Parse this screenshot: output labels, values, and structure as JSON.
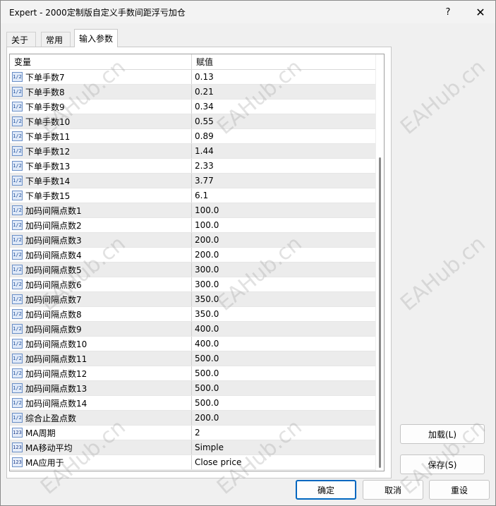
{
  "window": {
    "title": "Expert - 2000定制版自定义手数间距浮亏加仓",
    "help_glyph": "?",
    "close_glyph": "✕"
  },
  "tabs": [
    {
      "label": "关于",
      "active": false
    },
    {
      "label": "常用",
      "active": false
    },
    {
      "label": "输入参数",
      "active": true
    }
  ],
  "grid": {
    "headers": {
      "variable": "变量",
      "value": "赋值"
    },
    "rows": [
      {
        "icon": "double-value-icon",
        "icon_text": "1/2",
        "name": "下单手数7",
        "value": "0.13"
      },
      {
        "icon": "double-value-icon",
        "icon_text": "1/2",
        "name": "下单手数8",
        "value": "0.21"
      },
      {
        "icon": "double-value-icon",
        "icon_text": "1/2",
        "name": "下单手数9",
        "value": "0.34"
      },
      {
        "icon": "double-value-icon",
        "icon_text": "1/2",
        "name": "下单手数10",
        "value": "0.55"
      },
      {
        "icon": "double-value-icon",
        "icon_text": "1/2",
        "name": "下单手数11",
        "value": "0.89"
      },
      {
        "icon": "double-value-icon",
        "icon_text": "1/2",
        "name": "下单手数12",
        "value": "1.44"
      },
      {
        "icon": "double-value-icon",
        "icon_text": "1/2",
        "name": "下单手数13",
        "value": "2.33"
      },
      {
        "icon": "double-value-icon",
        "icon_text": "1/2",
        "name": "下单手数14",
        "value": "3.77"
      },
      {
        "icon": "double-value-icon",
        "icon_text": "1/2",
        "name": "下单手数15",
        "value": "6.1"
      },
      {
        "icon": "double-value-icon",
        "icon_text": "1/2",
        "name": "加码间隔点数1",
        "value": "100.0"
      },
      {
        "icon": "double-value-icon",
        "icon_text": "1/2",
        "name": "加码间隔点数2",
        "value": "100.0"
      },
      {
        "icon": "double-value-icon",
        "icon_text": "1/2",
        "name": "加码间隔点数3",
        "value": "200.0"
      },
      {
        "icon": "double-value-icon",
        "icon_text": "1/2",
        "name": "加码间隔点数4",
        "value": "200.0"
      },
      {
        "icon": "double-value-icon",
        "icon_text": "1/2",
        "name": "加码间隔点数5",
        "value": "300.0"
      },
      {
        "icon": "double-value-icon",
        "icon_text": "1/2",
        "name": "加码间隔点数6",
        "value": "300.0"
      },
      {
        "icon": "double-value-icon",
        "icon_text": "1/2",
        "name": "加码间隔点数7",
        "value": "350.0"
      },
      {
        "icon": "double-value-icon",
        "icon_text": "1/2",
        "name": "加码间隔点数8",
        "value": "350.0"
      },
      {
        "icon": "double-value-icon",
        "icon_text": "1/2",
        "name": "加码间隔点数9",
        "value": "400.0"
      },
      {
        "icon": "double-value-icon",
        "icon_text": "1/2",
        "name": "加码间隔点数10",
        "value": "400.0"
      },
      {
        "icon": "double-value-icon",
        "icon_text": "1/2",
        "name": "加码间隔点数11",
        "value": "500.0"
      },
      {
        "icon": "double-value-icon",
        "icon_text": "1/2",
        "name": "加码间隔点数12",
        "value": "500.0"
      },
      {
        "icon": "double-value-icon",
        "icon_text": "1/2",
        "name": "加码间隔点数13",
        "value": "500.0"
      },
      {
        "icon": "double-value-icon",
        "icon_text": "1/2",
        "name": "加码间隔点数14",
        "value": "500.0"
      },
      {
        "icon": "double-value-icon",
        "icon_text": "1/2",
        "name": "综合止盈点数",
        "value": "200.0"
      },
      {
        "icon": "integer-value-icon",
        "icon_text": "123",
        "name": "MA周期",
        "value": "2"
      },
      {
        "icon": "integer-value-icon",
        "icon_text": "123",
        "name": "MA移动平均",
        "value": "Simple"
      },
      {
        "icon": "integer-value-icon",
        "icon_text": "123",
        "name": "MA应用于",
        "value": "Close price"
      }
    ]
  },
  "side_buttons": {
    "load": "加载(L)",
    "save": "保存(S)"
  },
  "footer_buttons": {
    "ok": "确定",
    "cancel": "取消",
    "reset": "重设"
  },
  "watermark_text": "EAHub.cn"
}
